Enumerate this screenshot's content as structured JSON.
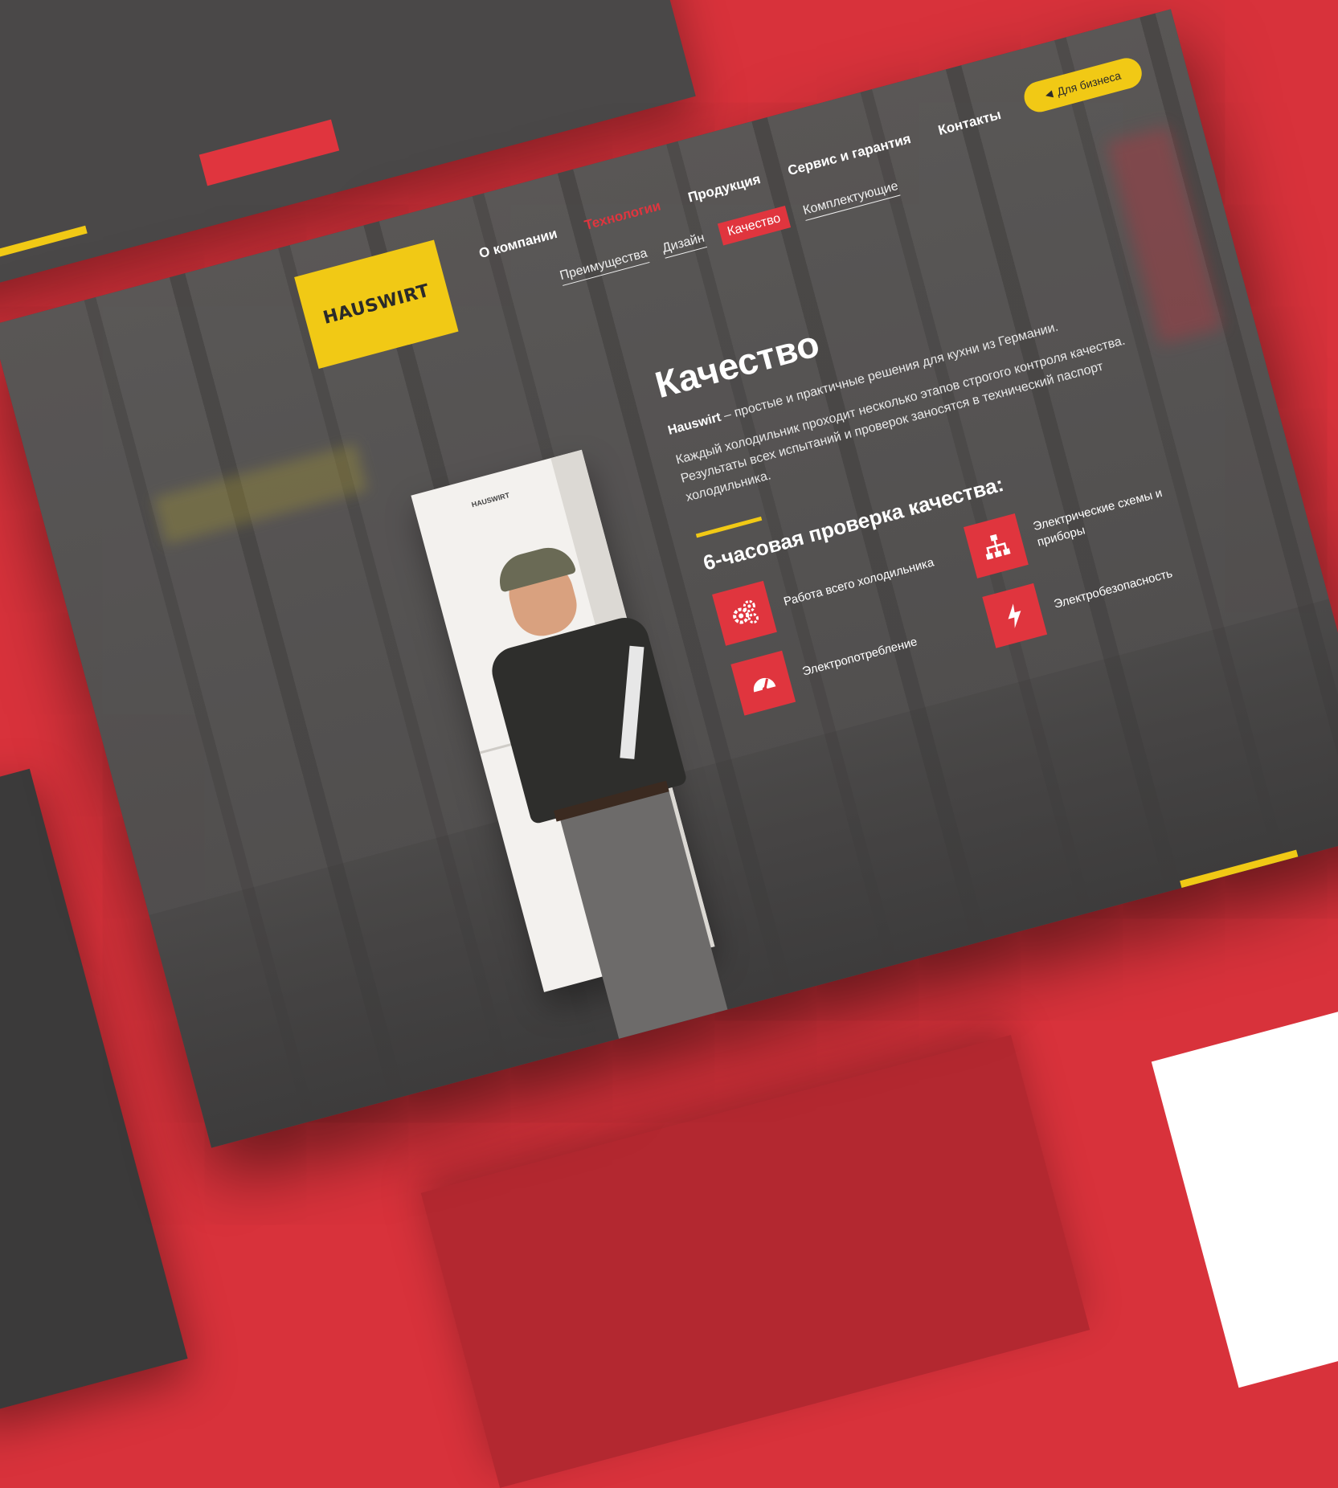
{
  "logo": {
    "text": "HAUSWIRT"
  },
  "nav": {
    "main": [
      {
        "label": "О компании",
        "active": false
      },
      {
        "label": "Технологии",
        "active": true
      },
      {
        "label": "Продукция",
        "active": false
      },
      {
        "label": "Сервис и гарантия",
        "active": false
      },
      {
        "label": "Контакты",
        "active": false
      }
    ],
    "sub": [
      {
        "label": "Преимущества",
        "active": false
      },
      {
        "label": "Дизайн",
        "active": false
      },
      {
        "label": "Качество",
        "active": true
      },
      {
        "label": "Комплектующие",
        "active": false
      }
    ],
    "business_button": "Для бизнеса"
  },
  "fridge": {
    "brand": "HAUSWIRT"
  },
  "content": {
    "title": "Качество",
    "intro_brand": "Hauswirt",
    "intro_text": " – простые и практичные решения для кухни из Германии.",
    "paragraph": "Каждый холодильник проходит несколько этапов строгого контроля качества. Результаты всех испытаний и проверок заносятся в технический паспорт холодильника.",
    "subtitle": "6-часовая проверка качества:",
    "features": [
      {
        "icon": "gears-icon",
        "label": "Работа всего холодильника"
      },
      {
        "icon": "circuit-scheme-icon",
        "label": "Электрические схемы и приборы"
      },
      {
        "icon": "gauge-icon",
        "label": "Электропотребление"
      },
      {
        "icon": "lightning-icon",
        "label": "Электробезопасность"
      }
    ]
  },
  "colors": {
    "accent_red": "#e0353e",
    "accent_yellow": "#f1c915",
    "screen_bg": "#4b4848"
  }
}
